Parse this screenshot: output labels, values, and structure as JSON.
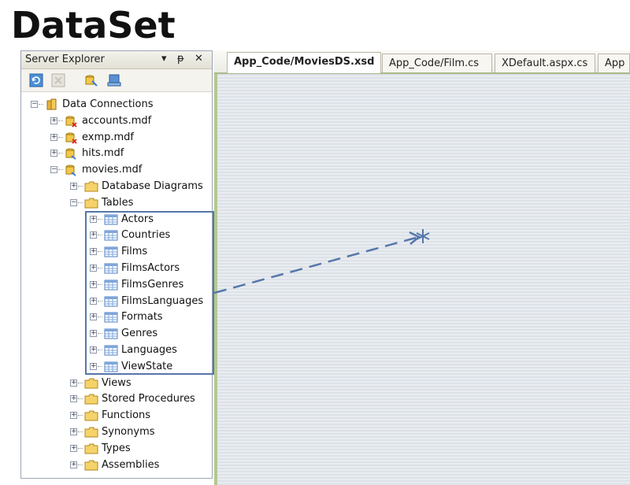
{
  "slide_title": "DataSet",
  "server_explorer": {
    "title": "Server Explorer",
    "pin_glyph": "▾",
    "autohide_glyph": "ᵽ",
    "close_glyph": "✕",
    "toolbar_icons": [
      "refresh-icon",
      "stop-icon",
      "connect-database-icon",
      "connect-server-icon"
    ],
    "tree": [
      {
        "label": "Data Connections",
        "indent": 0,
        "expander": "−",
        "icon": "data-connections-icon"
      },
      {
        "label": "accounts.mdf",
        "indent": 1,
        "expander": "+",
        "icon": "database-error-icon"
      },
      {
        "label": "exmp.mdf",
        "indent": 1,
        "expander": "+",
        "icon": "database-error-icon"
      },
      {
        "label": "hits.mdf",
        "indent": 1,
        "expander": "+",
        "icon": "database-icon"
      },
      {
        "label": "movies.mdf",
        "indent": 1,
        "expander": "−",
        "icon": "database-icon"
      },
      {
        "label": "Database Diagrams",
        "indent": 2,
        "expander": "+",
        "icon": "folder-icon"
      },
      {
        "label": "Tables",
        "indent": 2,
        "expander": "−",
        "icon": "folder-icon"
      },
      {
        "label": "Actors",
        "indent": 3,
        "expander": "+",
        "icon": "table-icon"
      },
      {
        "label": "Countries",
        "indent": 3,
        "expander": "+",
        "icon": "table-icon"
      },
      {
        "label": "Films",
        "indent": 3,
        "expander": "+",
        "icon": "table-icon"
      },
      {
        "label": "FilmsActors",
        "indent": 3,
        "expander": "+",
        "icon": "table-icon"
      },
      {
        "label": "FilmsGenres",
        "indent": 3,
        "expander": "+",
        "icon": "table-icon"
      },
      {
        "label": "FilmsLanguages",
        "indent": 3,
        "expander": "+",
        "icon": "table-icon"
      },
      {
        "label": "Formats",
        "indent": 3,
        "expander": "+",
        "icon": "table-icon"
      },
      {
        "label": "Genres",
        "indent": 3,
        "expander": "+",
        "icon": "table-icon"
      },
      {
        "label": "Languages",
        "indent": 3,
        "expander": "+",
        "icon": "table-icon"
      },
      {
        "label": "ViewState",
        "indent": 3,
        "expander": "+",
        "icon": "table-icon"
      },
      {
        "label": "Views",
        "indent": 2,
        "expander": "+",
        "icon": "folder-icon"
      },
      {
        "label": "Stored Procedures",
        "indent": 2,
        "expander": "+",
        "icon": "folder-icon"
      },
      {
        "label": "Functions",
        "indent": 2,
        "expander": "+",
        "icon": "folder-icon"
      },
      {
        "label": "Synonyms",
        "indent": 2,
        "expander": "+",
        "icon": "folder-icon"
      },
      {
        "label": "Types",
        "indent": 2,
        "expander": "+",
        "icon": "folder-icon"
      },
      {
        "label": "Assemblies",
        "indent": 2,
        "expander": "+",
        "icon": "folder-icon"
      }
    ]
  },
  "tabs": [
    {
      "label": "App_Code/MoviesDS.xsd",
      "active": true
    },
    {
      "label": "App_Code/Film.cs",
      "active": false
    },
    {
      "label": "XDefault.aspx.cs",
      "active": false
    },
    {
      "label": "App",
      "active": false
    }
  ],
  "colors": {
    "highlight": "#5577aa",
    "tab_accent": "#a9b88a",
    "editor_background": "#e3e7ec"
  }
}
